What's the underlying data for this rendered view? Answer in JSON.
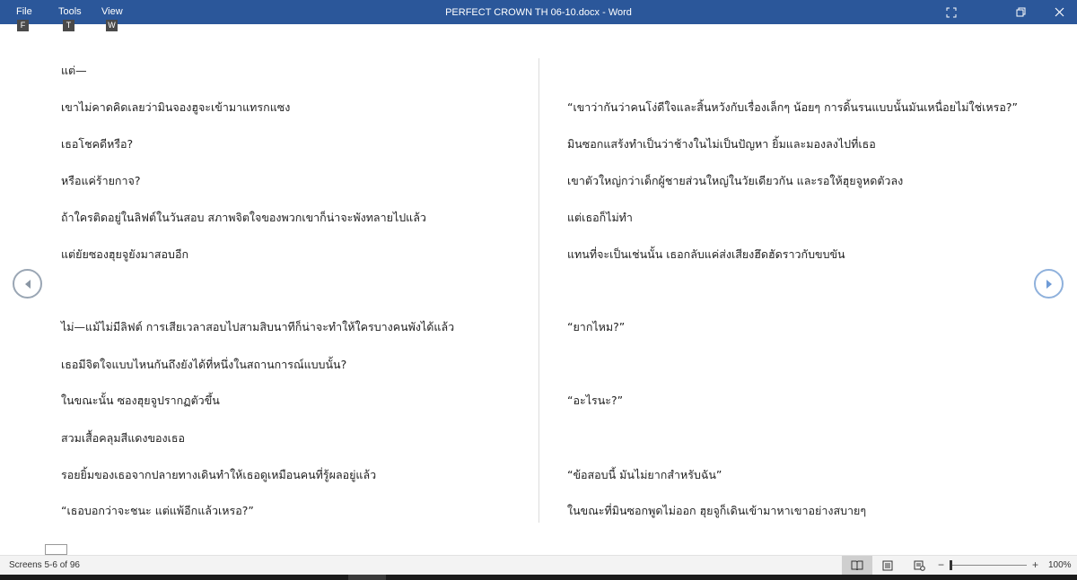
{
  "titlebar": {
    "menus": [
      {
        "label": "File",
        "keytip": "F"
      },
      {
        "label": "Tools",
        "keytip": "T"
      },
      {
        "label": "View",
        "keytip": "W"
      }
    ],
    "document_title": "PERFECT CROWN TH 06-10.docx  -  Word"
  },
  "page_left": {
    "paragraphs": [
      "แต่—",
      "เขาไม่คาดคิดเลยว่ามินจองฮูจะเข้ามาแทรกแซง",
      "เธอโชคดีหรือ?",
      "หรือแค่ร้ายกาจ?",
      "ถ้าใครติดอยู่ในลิฟต์ในวันสอบ สภาพจิตใจของพวกเขาก็น่าจะพังทลายไปแล้ว",
      "แต่ยัยซองฮุยจูยังมาสอบอีก",
      "ไม่—แม้ไม่มีลิฟต์ การเสียเวลาสอบไปสามสิบนาทีก็น่าจะทำให้ใครบางคนพังได้แล้ว",
      "เธอมีจิตใจแบบไหนกันถึงยังได้ที่หนึ่งในสถานการณ์แบบนั้น?",
      "ในขณะนั้น ซองฮุยจูปรากฏตัวขึ้น",
      "สวมเสื้อคลุมสีแดงของเธอ",
      "รอยยิ้มของเธอจากปลายทางเดินทำให้เธอดูเหมือนคนที่รู้ผลอยู่แล้ว",
      "“เธอบอกว่าจะชนะ แต่แพ้อีกแล้วเหรอ?”"
    ]
  },
  "page_right": {
    "paragraphs": [
      "“เขาว่ากันว่าคนโง่ดีใจและสิ้นหวังกับเรื่องเล็กๆ น้อยๆ การดิ้นรนแบบนั้นมันเหนื่อยไม่ใช่เหรอ?”",
      "มินซอกแสร้งทำเป็นว่าช้างในไม่เป็นปัญหา ยิ้มและมองลงไปที่เธอ",
      "เขาตัวใหญ่กว่าเด็กผู้ชายส่วนใหญ่ในวัยเดียวกัน และรอให้ฮุยจูหดตัวลง",
      "แต่เธอก็ไม่ทำ",
      "แทนที่จะเป็นเช่นนั้น เธอกลับแค่ส่งเสียงฮึดฮัดราวกับขบขัน",
      "“ยากไหม?”",
      "“อะไรนะ?”",
      "“ข้อสอบนี้ มันไม่ยากสำหรับฉัน”",
      "ในขณะที่มินซอกพูดไม่ออก ฮุยจูก็เดินเข้ามาหาเขาอย่างสบายๆ"
    ]
  },
  "statusbar": {
    "screens": "Screens 5-6 of 96",
    "zoom_minus": "−",
    "zoom_plus": "+",
    "zoom_level": "100%",
    "zoom_fraction": 0.0
  },
  "colors": {
    "titlebar": "#2b579a",
    "statusbar": "#f3f3f3",
    "text": "#222222"
  }
}
